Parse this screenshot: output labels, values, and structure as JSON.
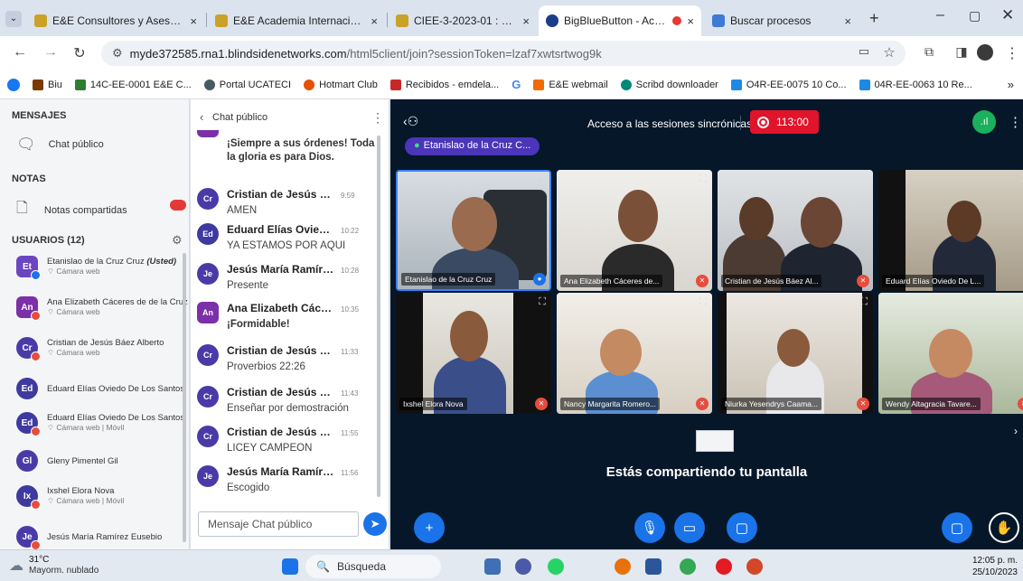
{
  "browser": {
    "tabs": [
      {
        "title": "E&E Consultores y Asesores",
        "color": "#c9a227"
      },
      {
        "title": "E&E Academia Internacional",
        "color": "#c9a227"
      },
      {
        "title": "CIEE-3-2023-01 : Participant",
        "color": "#c9a227"
      },
      {
        "title": "BigBlueButton - Acceso",
        "color": "#1a73e8"
      },
      {
        "title": "Buscar procesos",
        "color": "#3b7bd6"
      }
    ],
    "url_host": "myde372585.rna1.blindsidenetworks.com",
    "url_path": "/html5client/join?sessionToken=lzaf7xwtsrtwog9k",
    "bookmarks": [
      {
        "label": "Biu",
        "color": "#7a3a00"
      },
      {
        "label": "14C-EE-0001 E&E C...",
        "color": "#2e7d32"
      },
      {
        "label": "Portal UCATECI",
        "color": "#455a64"
      },
      {
        "label": "Hotmart Club",
        "color": "#e65100"
      },
      {
        "label": "Recibidos - emdela...",
        "color": "#c62828"
      },
      {
        "label": "E&E webmail",
        "color": "#ef6c00"
      },
      {
        "label": "Scribd downloader",
        "color": "#00897b"
      },
      {
        "label": "O4R-EE-0075 10 Co...",
        "color": "#1e88e5"
      },
      {
        "label": "04R-EE-0063 10 Re...",
        "color": "#1e88e5"
      }
    ]
  },
  "sidebar": {
    "mensajes_heading": "MENSAJES",
    "chat_publico": "Chat público",
    "notas_heading": "NOTAS",
    "notas_compartidas": "Notas compartidas",
    "usuarios_heading": "USUARIOS (12)",
    "users": [
      {
        "initials": "Et",
        "name": "Etanislao de la Cruz Cruz",
        "suffix": "(Usted)",
        "sub": "Cámara web",
        "color": "#6b46c1",
        "badge": "blue"
      },
      {
        "initials": "An",
        "name": "Ana Elizabeth Cáceres de de la Cruz",
        "suffix": "",
        "sub": "Cámara web",
        "color": "#7b2fa8",
        "badge": "red"
      },
      {
        "initials": "Cr",
        "name": "Cristian de Jesús Báez Alberto",
        "suffix": "",
        "sub": "Cámara web",
        "color": "#4a3aa8",
        "badge": "red"
      },
      {
        "initials": "Ed",
        "name": "Eduard Elías Oviedo De Los Santos",
        "suffix": "",
        "sub": "",
        "color": "#3f3aa0",
        "badge": ""
      },
      {
        "initials": "Ed",
        "name": "Eduard Elías Oviedo De Los Santos",
        "suffix": "",
        "sub": "Cámara web | Móvil",
        "color": "#3f3aa0",
        "badge": "red"
      },
      {
        "initials": "Gl",
        "name": "Gleny Pimentel Gil",
        "suffix": "",
        "sub": "",
        "color": "#4a3aa8",
        "badge": ""
      },
      {
        "initials": "Ix",
        "name": "Ixshel Elora Nova",
        "suffix": "",
        "sub": "Cámara web | Móvil",
        "color": "#3f3aa0",
        "badge": "red"
      },
      {
        "initials": "Je",
        "name": "Jesús María Ramírez Eusebio",
        "suffix": "",
        "sub": "",
        "color": "#4a3aa8",
        "badge": "red"
      }
    ]
  },
  "chat": {
    "header": "Chat público",
    "first_msg": "¡Siempre a sus órdenes! Toda la gloria es para Dios.",
    "messages": [
      {
        "initials": "Cr",
        "name": "Cristian de Jesús Báe...",
        "time": "9:59",
        "text": "AMEN",
        "color": "#4a3aa8"
      },
      {
        "initials": "Ed",
        "name": "Eduard Elías Oviedo ...",
        "time": "10:22",
        "text": "YA ESTAMOS POR AQUI",
        "color": "#3f3aa0"
      },
      {
        "initials": "Je",
        "name": "Jesús María Ramírez ...",
        "time": "10:28",
        "text": "Presente",
        "color": "#4a3aa8"
      },
      {
        "initials": "An",
        "name": "Ana Elizabeth Cácere...",
        "time": "10:35",
        "text": "¡Formidable!",
        "color": "#7b2fa8"
      },
      {
        "initials": "Cr",
        "name": "Cristian de Jesús Báe...",
        "time": "11:33",
        "text": "Proverbios 22:26",
        "color": "#4a3aa8"
      },
      {
        "initials": "Cr",
        "name": "Cristian de Jesús Báe...",
        "time": "11:43",
        "text": "Enseñar por demostración",
        "color": "#4a3aa8"
      },
      {
        "initials": "Cr",
        "name": "Cristian de Jesús Báe...",
        "time": "11:55",
        "text": "LICEY CAMPEON",
        "color": "#4a3aa8"
      },
      {
        "initials": "Je",
        "name": "Jesús María Ramírez ...",
        "time": "11:56",
        "text": "Escogido",
        "color": "#4a3aa8"
      }
    ],
    "input_placeholder": "Mensaje Chat público"
  },
  "meeting": {
    "title": "Acceso a las sesiones sincrónicas",
    "recording_time": "113:00",
    "presenter": "Etanislao de la Cruz C...",
    "tiles": [
      {
        "name": "Etanislao de la Cruz Cruz",
        "mic": "on"
      },
      {
        "name": "Ana Elizabeth Cáceres de...",
        "mic": "off"
      },
      {
        "name": "Cristian de Jesús Báez Al...",
        "mic": "off"
      },
      {
        "name": "Eduard Elías Oviedo De L...",
        "mic": "off"
      },
      {
        "name": "Ixshel Elora Nova",
        "mic": "off"
      },
      {
        "name": "Nancy Margarita Romero...",
        "mic": "off"
      },
      {
        "name": "Niurka Yesendrys Caama...",
        "mic": "off"
      },
      {
        "name": "Wendy Altagracia Tavare...",
        "mic": "off"
      }
    ],
    "sharing_text": "Estás compartiendo tu pantalla"
  },
  "taskbar": {
    "weather_temp": "31°C",
    "weather_desc": "Mayorm. nublado",
    "search": "Búsqueda",
    "time": "12:05 p. m.",
    "date": "25/10/2023"
  }
}
